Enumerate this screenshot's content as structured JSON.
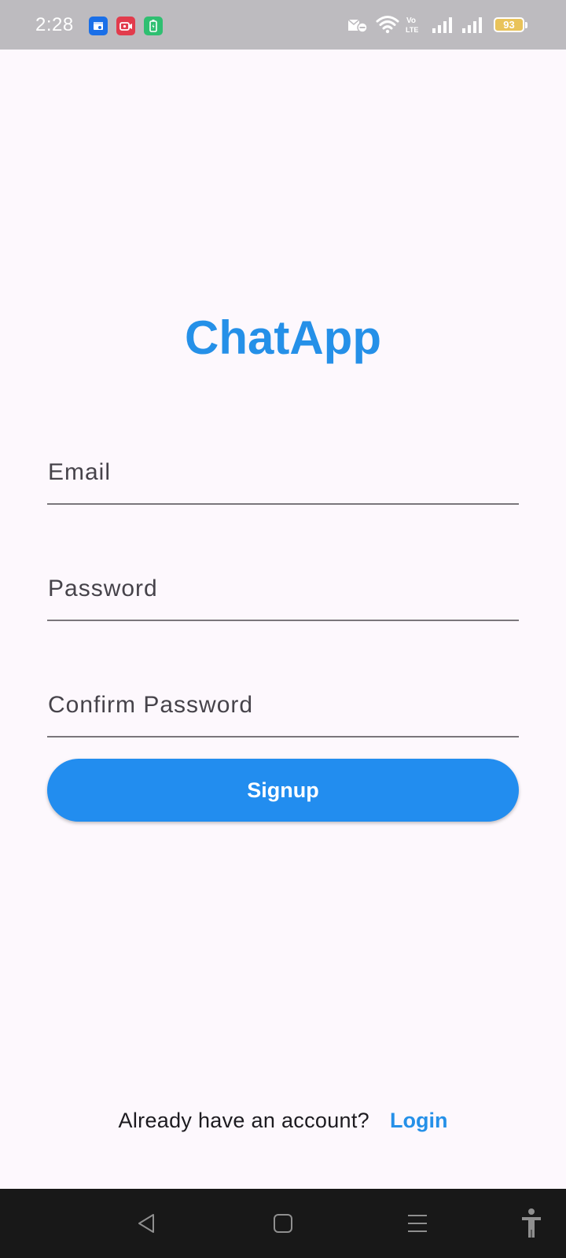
{
  "status_bar": {
    "time": "2:28",
    "battery_level": "93",
    "notification_icons": [
      "calendar-app-icon",
      "screen-recorder-icon",
      "battery-saver-icon"
    ],
    "system_icons": [
      "do-not-disturb-icon",
      "wifi-icon",
      "volte-icon",
      "signal-icon",
      "signal-icon",
      "battery-icon"
    ],
    "colors": {
      "background": "#bdbbbf",
      "battery_fill": "#e9c35a"
    }
  },
  "app": {
    "title": "ChatApp",
    "title_color": "#2590e8"
  },
  "form": {
    "email": {
      "placeholder": "Email",
      "value": ""
    },
    "password": {
      "placeholder": "Password",
      "value": ""
    },
    "confirm_password": {
      "placeholder": "Confirm Password",
      "value": ""
    },
    "signup_label": "Signup",
    "button_color": "#228def"
  },
  "footer": {
    "prompt": "Already have an account?",
    "login_label": "Login"
  },
  "nav_bar": {
    "buttons": [
      "back-icon",
      "home-icon",
      "recents-icon",
      "accessibility-icon"
    ]
  }
}
